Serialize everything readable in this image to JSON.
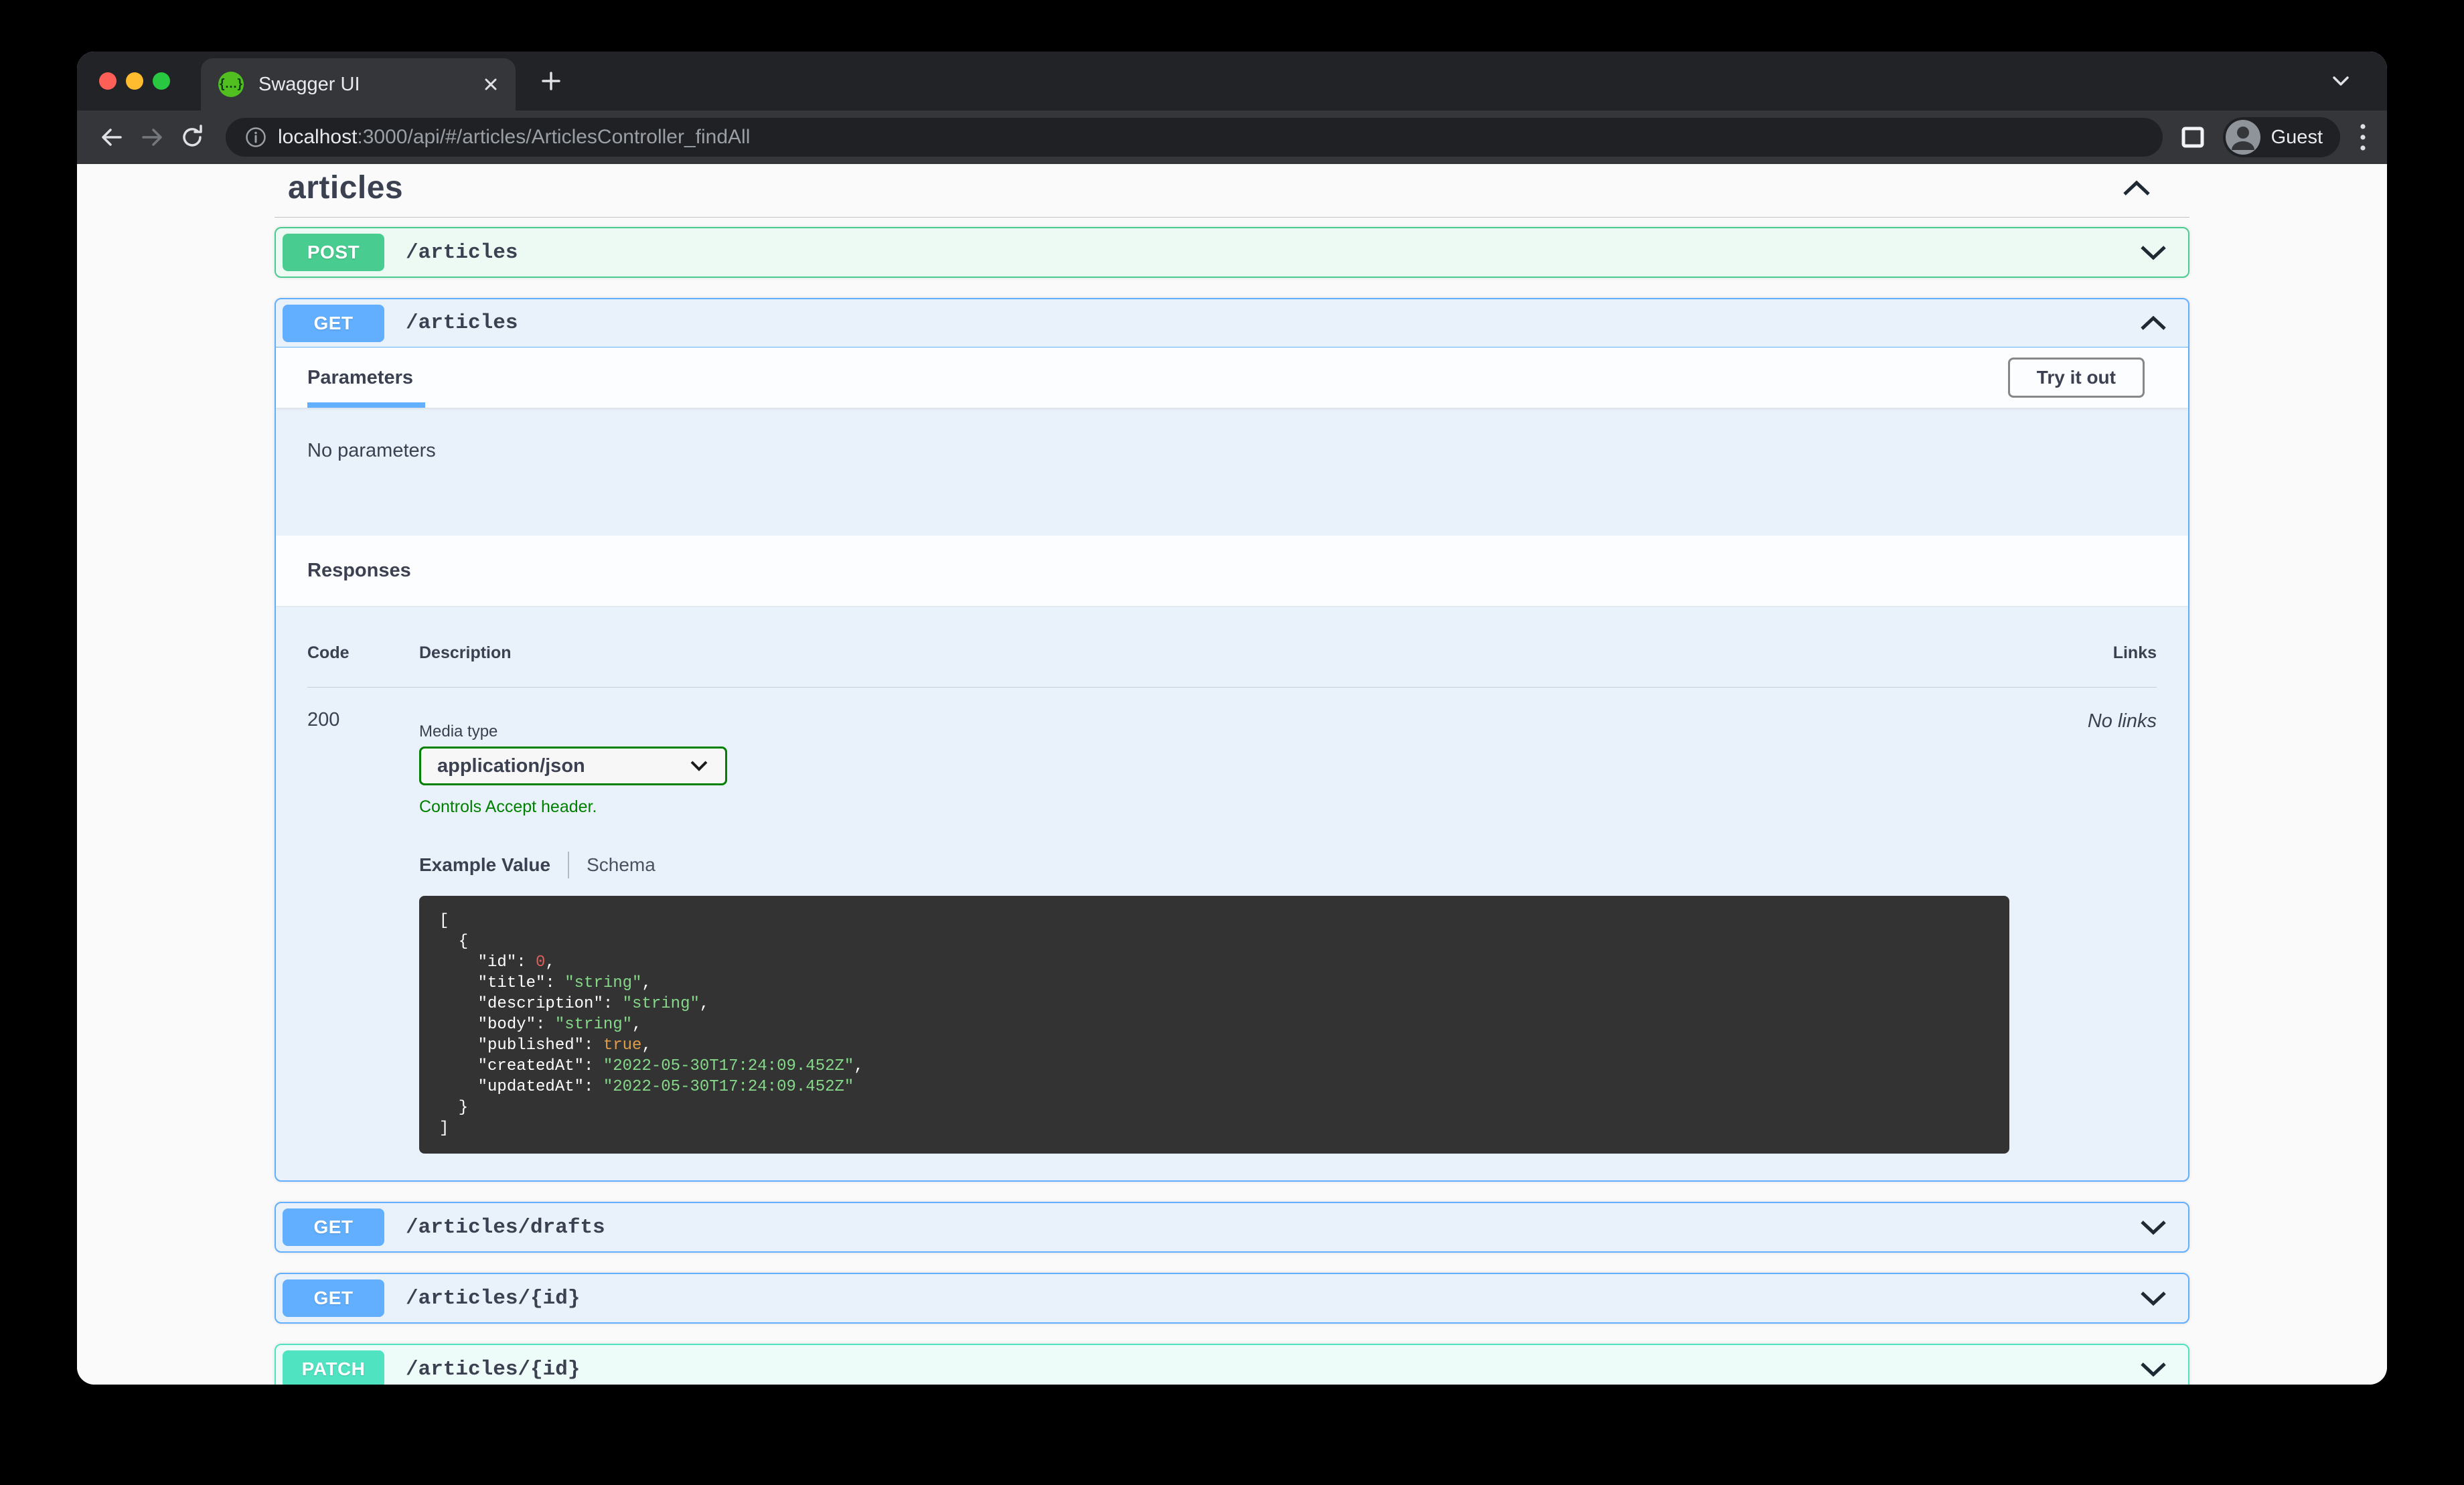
{
  "browser": {
    "tab_title": "Swagger UI",
    "url_host": "localhost",
    "url_rest": ":3000/api/#/articles/ArticlesController_findAll",
    "profile_label": "Guest",
    "favicon_glyph": "{…}"
  },
  "page": {
    "section_title": "articles",
    "operations": [
      {
        "method": "POST",
        "path": "/articles",
        "state": "collapsed"
      },
      {
        "method": "GET",
        "path": "/articles",
        "state": "expanded"
      },
      {
        "method": "GET",
        "path": "/articles/drafts",
        "state": "collapsed"
      },
      {
        "method": "GET",
        "path": "/articles/{id}",
        "state": "collapsed"
      },
      {
        "method": "PATCH",
        "path": "/articles/{id}",
        "state": "collapsed"
      }
    ],
    "expanded": {
      "parameters_tab": "Parameters",
      "try_it_out": "Try it out",
      "no_parameters": "No parameters",
      "responses_title": "Responses",
      "code_header": "Code",
      "description_header": "Description",
      "links_header": "Links",
      "response": {
        "code": "200",
        "media_type_label": "Media type",
        "media_type_value": "application/json",
        "accept_note": "Controls Accept header.",
        "example_tab": "Example Value",
        "schema_tab": "Schema",
        "no_links": "No links",
        "example_json": [
          [
            {
              "t": "[",
              "c": "p"
            }
          ],
          [
            {
              "t": "  {",
              "c": "p"
            }
          ],
          [
            {
              "t": "    \"id\": ",
              "c": "p"
            },
            {
              "t": "0",
              "c": "num"
            },
            {
              "t": ",",
              "c": "p"
            }
          ],
          [
            {
              "t": "    \"title\": ",
              "c": "p"
            },
            {
              "t": "\"string\"",
              "c": "str"
            },
            {
              "t": ",",
              "c": "p"
            }
          ],
          [
            {
              "t": "    \"description\": ",
              "c": "p"
            },
            {
              "t": "\"string\"",
              "c": "str"
            },
            {
              "t": ",",
              "c": "p"
            }
          ],
          [
            {
              "t": "    \"body\": ",
              "c": "p"
            },
            {
              "t": "\"string\"",
              "c": "str"
            },
            {
              "t": ",",
              "c": "p"
            }
          ],
          [
            {
              "t": "    \"published\": ",
              "c": "p"
            },
            {
              "t": "true",
              "c": "bool"
            },
            {
              "t": ",",
              "c": "p"
            }
          ],
          [
            {
              "t": "    \"createdAt\": ",
              "c": "p"
            },
            {
              "t": "\"2022-05-30T17:24:09.452Z\"",
              "c": "str"
            },
            {
              "t": ",",
              "c": "p"
            }
          ],
          [
            {
              "t": "    \"updatedAt\": ",
              "c": "p"
            },
            {
              "t": "\"2022-05-30T17:24:09.452Z\"",
              "c": "str"
            }
          ],
          [
            {
              "t": "  }",
              "c": "p"
            }
          ],
          [
            {
              "t": "]",
              "c": "p"
            }
          ]
        ]
      }
    }
  },
  "colors": {
    "method_post": "#49cc90",
    "method_get": "#61affe",
    "method_patch": "#50e3c2",
    "accept_green": "#008000",
    "text_main": "#3b4151",
    "code_bg": "#333333",
    "code_string": "#85d989",
    "code_number": "#d9605c",
    "code_boolean": "#de9b48",
    "page_bg": "#fafafa"
  }
}
